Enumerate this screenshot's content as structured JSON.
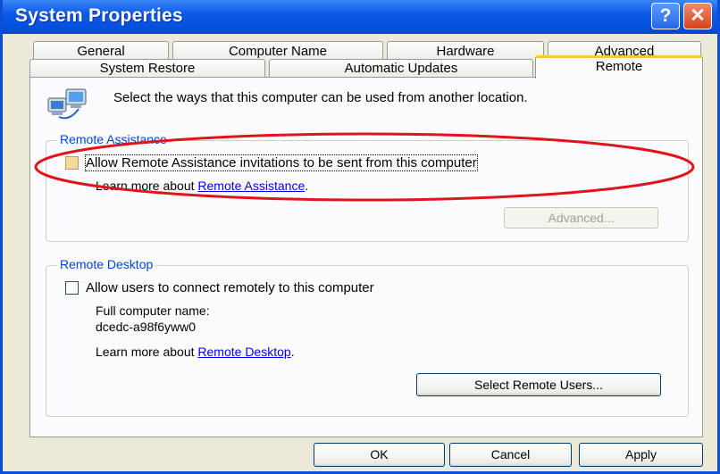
{
  "window": {
    "title": "System Properties",
    "help_glyph": "?",
    "close_glyph": "✕"
  },
  "tabs": {
    "row_back": [
      "General",
      "Computer Name",
      "Hardware",
      "Advanced"
    ],
    "row_front": [
      "System Restore",
      "Automatic Updates",
      "Remote"
    ],
    "active": "Remote"
  },
  "intro": {
    "icon": "computers-network-icon",
    "text": "Select the ways that this computer can be used from another location."
  },
  "remote_assistance": {
    "label": "Remote Assistance",
    "allow_checkbox_label": "Allow Remote Assistance invitations to be sent from this computer",
    "allow_checked": false,
    "learn_prefix": "Learn more about ",
    "learn_link": "Remote Assistance",
    "learn_suffix": ".",
    "advanced_button": "Advanced..."
  },
  "remote_desktop": {
    "label": "Remote Desktop",
    "allow_checkbox_label": "Allow users to connect remotely to this computer",
    "allow_checked": false,
    "full_name_label": "Full computer name:",
    "full_name_value": "dcedc-a98f6yww0",
    "learn_prefix": "Learn more about ",
    "learn_link": "Remote Desktop",
    "learn_suffix": ".",
    "select_users_button": "Select Remote Users..."
  },
  "footer": {
    "ok": "OK",
    "cancel": "Cancel",
    "apply": "Apply"
  },
  "colors": {
    "titlebar": "#0c5ae8",
    "group_label": "#0046d5",
    "annotation": "#e0141a"
  }
}
